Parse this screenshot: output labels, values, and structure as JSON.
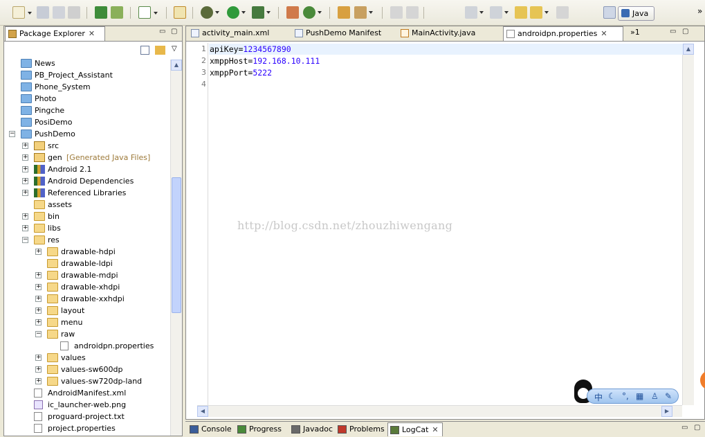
{
  "toolbar": {
    "perspective_label": "Java",
    "overflow_label": "»"
  },
  "package_explorer": {
    "title": "Package Explorer",
    "close_glyph": "✕",
    "tree": [
      {
        "label": "News",
        "type": "project",
        "level": 0
      },
      {
        "label": "PB_Project_Assistant",
        "type": "project",
        "level": 0
      },
      {
        "label": "Phone_System",
        "type": "project",
        "level": 0
      },
      {
        "label": "Photo",
        "type": "project",
        "level": 0
      },
      {
        "label": "Pingche",
        "type": "project",
        "level": 0
      },
      {
        "label": "PosiDemo",
        "type": "project",
        "level": 0
      },
      {
        "label": "PushDemo",
        "type": "project",
        "level": 0,
        "expander": "−"
      },
      {
        "label": "src",
        "type": "pkg",
        "level": 1,
        "expander": "+"
      },
      {
        "label": "gen",
        "decor": "[Generated Java Files]",
        "type": "pkg",
        "level": 1,
        "expander": "+"
      },
      {
        "label": "Android 2.1",
        "type": "lib",
        "level": 1,
        "expander": "+"
      },
      {
        "label": "Android Dependencies",
        "type": "lib",
        "level": 1,
        "expander": "+"
      },
      {
        "label": "Referenced Libraries",
        "type": "lib",
        "level": 1,
        "expander": "+"
      },
      {
        "label": "assets",
        "type": "folder",
        "level": 1
      },
      {
        "label": "bin",
        "type": "folder",
        "level": 1,
        "expander": "+"
      },
      {
        "label": "libs",
        "type": "folder",
        "level": 1,
        "expander": "+"
      },
      {
        "label": "res",
        "type": "folder",
        "level": 1,
        "expander": "−"
      },
      {
        "label": "drawable-hdpi",
        "type": "folder",
        "level": 2,
        "expander": "+"
      },
      {
        "label": "drawable-ldpi",
        "type": "folder",
        "level": 2
      },
      {
        "label": "drawable-mdpi",
        "type": "folder",
        "level": 2,
        "expander": "+"
      },
      {
        "label": "drawable-xhdpi",
        "type": "folder",
        "level": 2,
        "expander": "+"
      },
      {
        "label": "drawable-xxhdpi",
        "type": "folder",
        "level": 2,
        "expander": "+"
      },
      {
        "label": "layout",
        "type": "folder",
        "level": 2,
        "expander": "+"
      },
      {
        "label": "menu",
        "type": "folder",
        "level": 2,
        "expander": "+"
      },
      {
        "label": "raw",
        "type": "folder",
        "level": 2,
        "expander": "−"
      },
      {
        "label": "androidpn.properties",
        "type": "file",
        "level": 3
      },
      {
        "label": "values",
        "type": "folder",
        "level": 2,
        "expander": "+"
      },
      {
        "label": "values-sw600dp",
        "type": "folder",
        "level": 2,
        "expander": "+"
      },
      {
        "label": "values-sw720dp-land",
        "type": "folder",
        "level": 2,
        "expander": "+"
      },
      {
        "label": "AndroidManifest.xml",
        "type": "file",
        "level": 1
      },
      {
        "label": "ic_launcher-web.png",
        "type": "png",
        "level": 1
      },
      {
        "label": "proguard-project.txt",
        "type": "file",
        "level": 1
      },
      {
        "label": "project.properties",
        "type": "file",
        "level": 1
      }
    ]
  },
  "editor": {
    "tabs": [
      {
        "label": "activity_main.xml"
      },
      {
        "label": "PushDemo Manifest"
      },
      {
        "label": "MainActivity.java"
      },
      {
        "label": "androidpn.properties",
        "active": true
      }
    ],
    "overflow_count": "»1",
    "lines": [
      {
        "num": "1",
        "key": "apiKey=",
        "value": "1234567890"
      },
      {
        "num": "2",
        "key": "xmppHost=",
        "value": "192.168.10.111"
      },
      {
        "num": "3",
        "key": "xmppPort=",
        "value": "5222"
      },
      {
        "num": "4",
        "key": "",
        "value": ""
      }
    ],
    "watermark": "http://blog.csdn.net/zhouzhiwengang"
  },
  "bottom_panel": {
    "tabs": [
      {
        "label": "Console"
      },
      {
        "label": "Progress"
      },
      {
        "label": "Javadoc"
      },
      {
        "label": "Problems"
      },
      {
        "label": "LogCat",
        "active": true
      }
    ]
  },
  "ime": {
    "mode_label": "中"
  }
}
